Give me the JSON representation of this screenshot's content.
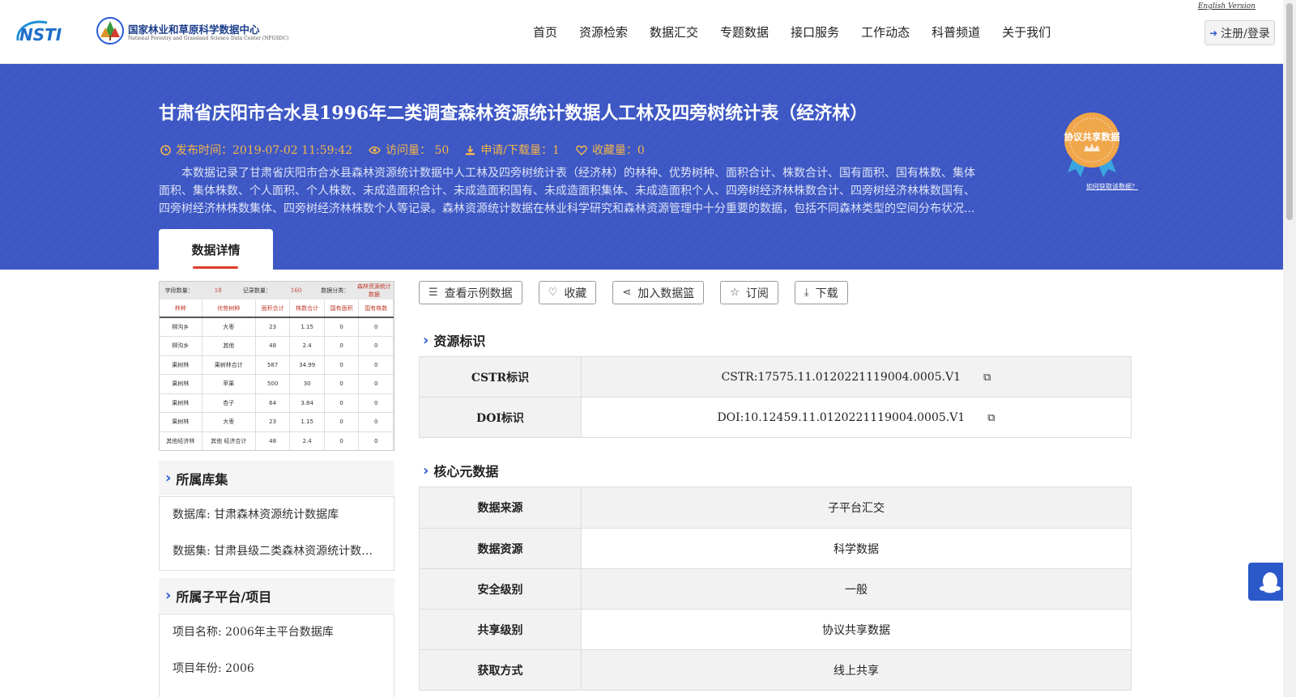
{
  "header": {
    "logo_text": "NSTI",
    "org_name_cn": "国家林业和草原科学数据中心",
    "org_name_en": "National Forestry and Grassland Science Data Center (NFGSDC)",
    "english_link": "English Version",
    "login_label": "注册/登录",
    "nav": [
      "首页",
      "资源检索",
      "数据汇交",
      "专题数据",
      "接口服务",
      "工作动态",
      "科普频道",
      "关于我们"
    ]
  },
  "dataset": {
    "title": "甘肃省庆阳市合水县1996年二类调查森林资源统计数据人工林及四旁树统计表（经济林）",
    "publish_time": "发布时间：2019-07-02 11:59:42",
    "visits": "访问量： 50",
    "downloads": "申请/下载量：1",
    "favorites": "收藏量：0",
    "description": "本数据记录了甘肃省庆阳市合水县森林资源统计数据中人工林及四旁树统计表（经济林）的林种、优势树种、面积合计、株数合计、国有面积、国有株数、集体面积、集体株数、个人面积、个人株数、未成造面积合计、未成造面积国有、未成造面积集体、未成造面积个人、四旁树经济林株数合计、四旁树经济林株数国有、四旁树经济林株数集体、四旁树经济林株数个人等记录。森林资源统计数据在林业科学研究和森林资源管理中十分重要的数据，包括不同森林类型的空间分布状况...",
    "badge_text": "协议共享数据",
    "badge_link": "如何获取该数据？",
    "tab_label": "数据详情"
  },
  "preview": {
    "summary": [
      "字段数量：",
      "18",
      "记录数量：",
      "160",
      "数据分类：",
      "森林资源统计数据"
    ],
    "headers": [
      "林种",
      "优势树种",
      "面积合计",
      "株数合计",
      "国有面积",
      "国有株数"
    ],
    "rows": [
      [
        "柳沟乡",
        "大枣",
        "23",
        "1.15",
        "0",
        "0"
      ],
      [
        "柳沟乡",
        "其他",
        "48",
        "2.4",
        "0",
        "0"
      ],
      [
        "果树林",
        "果树林合计",
        "587",
        "34.99",
        "0",
        "0"
      ],
      [
        "果树林",
        "苹果",
        "500",
        "30",
        "0",
        "0"
      ],
      [
        "果树林",
        "杏子",
        "64",
        "3.84",
        "0",
        "0"
      ],
      [
        "果树林",
        "大枣",
        "23",
        "1.15",
        "0",
        "0"
      ],
      [
        "其他经济林",
        "其他 经济合计",
        "48",
        "2.4",
        "0",
        "0"
      ]
    ]
  },
  "sidebar": {
    "library_title": "所属库集",
    "library_rows": [
      "数据库: 甘肃森林资源统计数据库",
      "数据集: 甘肃县级二类森林资源统计数据集"
    ],
    "project_title": "所属子平台/项目",
    "project_rows": [
      "项目名称: 2006年主平台数据库",
      "项目年份: 2006"
    ]
  },
  "actions": [
    "查看示例数据",
    "收藏",
    "加入数据篮",
    "订阅",
    "下载"
  ],
  "identifiers": {
    "title": "资源标识",
    "rows": [
      {
        "key": "CSTR标识",
        "value": "CSTR:17575.11.0120221119004.0005.V1"
      },
      {
        "key": "DOI标识",
        "value": "DOI:10.12459.11.0120221119004.0005.V1"
      }
    ]
  },
  "core_meta": {
    "title": "核心元数据",
    "rows": [
      {
        "key": "数据来源",
        "value": "子平台汇交"
      },
      {
        "key": "数据资源",
        "value": "科学数据"
      },
      {
        "key": "安全级别",
        "value": "一般"
      },
      {
        "key": "共享级别",
        "value": "协议共享数据"
      },
      {
        "key": "获取方式",
        "value": "线上共享"
      }
    ]
  },
  "colors": {
    "banner": "#3d57c4",
    "meta_text": "#f2b54a",
    "accent": "#2a5bd7",
    "tab_underline": "#e03a2a",
    "badge": "#f0a64a"
  }
}
